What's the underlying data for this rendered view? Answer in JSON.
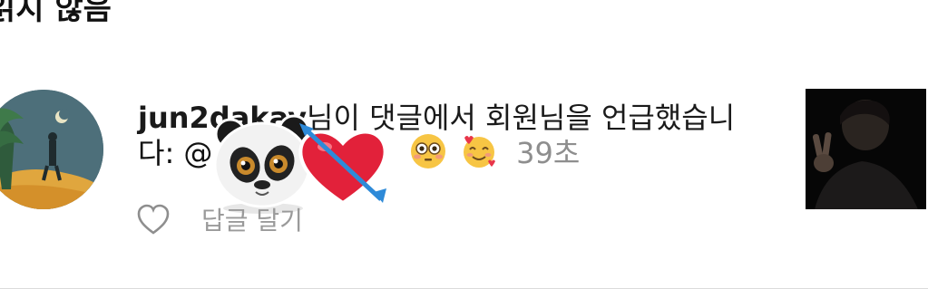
{
  "header": {
    "title": "읽지 않음"
  },
  "notification": {
    "username": "jun2dakay",
    "message_part1": "님이 댓글에서 회원님을 언급했습니",
    "message_part2": "다: @",
    "time": "39초",
    "reply_label": "답글 달기",
    "emojis": [
      "panda-sticker",
      "heart-with-arrow-sticker",
      "flushed-face-emoji",
      "smiling-face-with-hearts-emoji"
    ]
  },
  "colors": {
    "text": "#1a1a1a",
    "secondary": "#8e8e8e",
    "divider": "#dbdbdb"
  }
}
